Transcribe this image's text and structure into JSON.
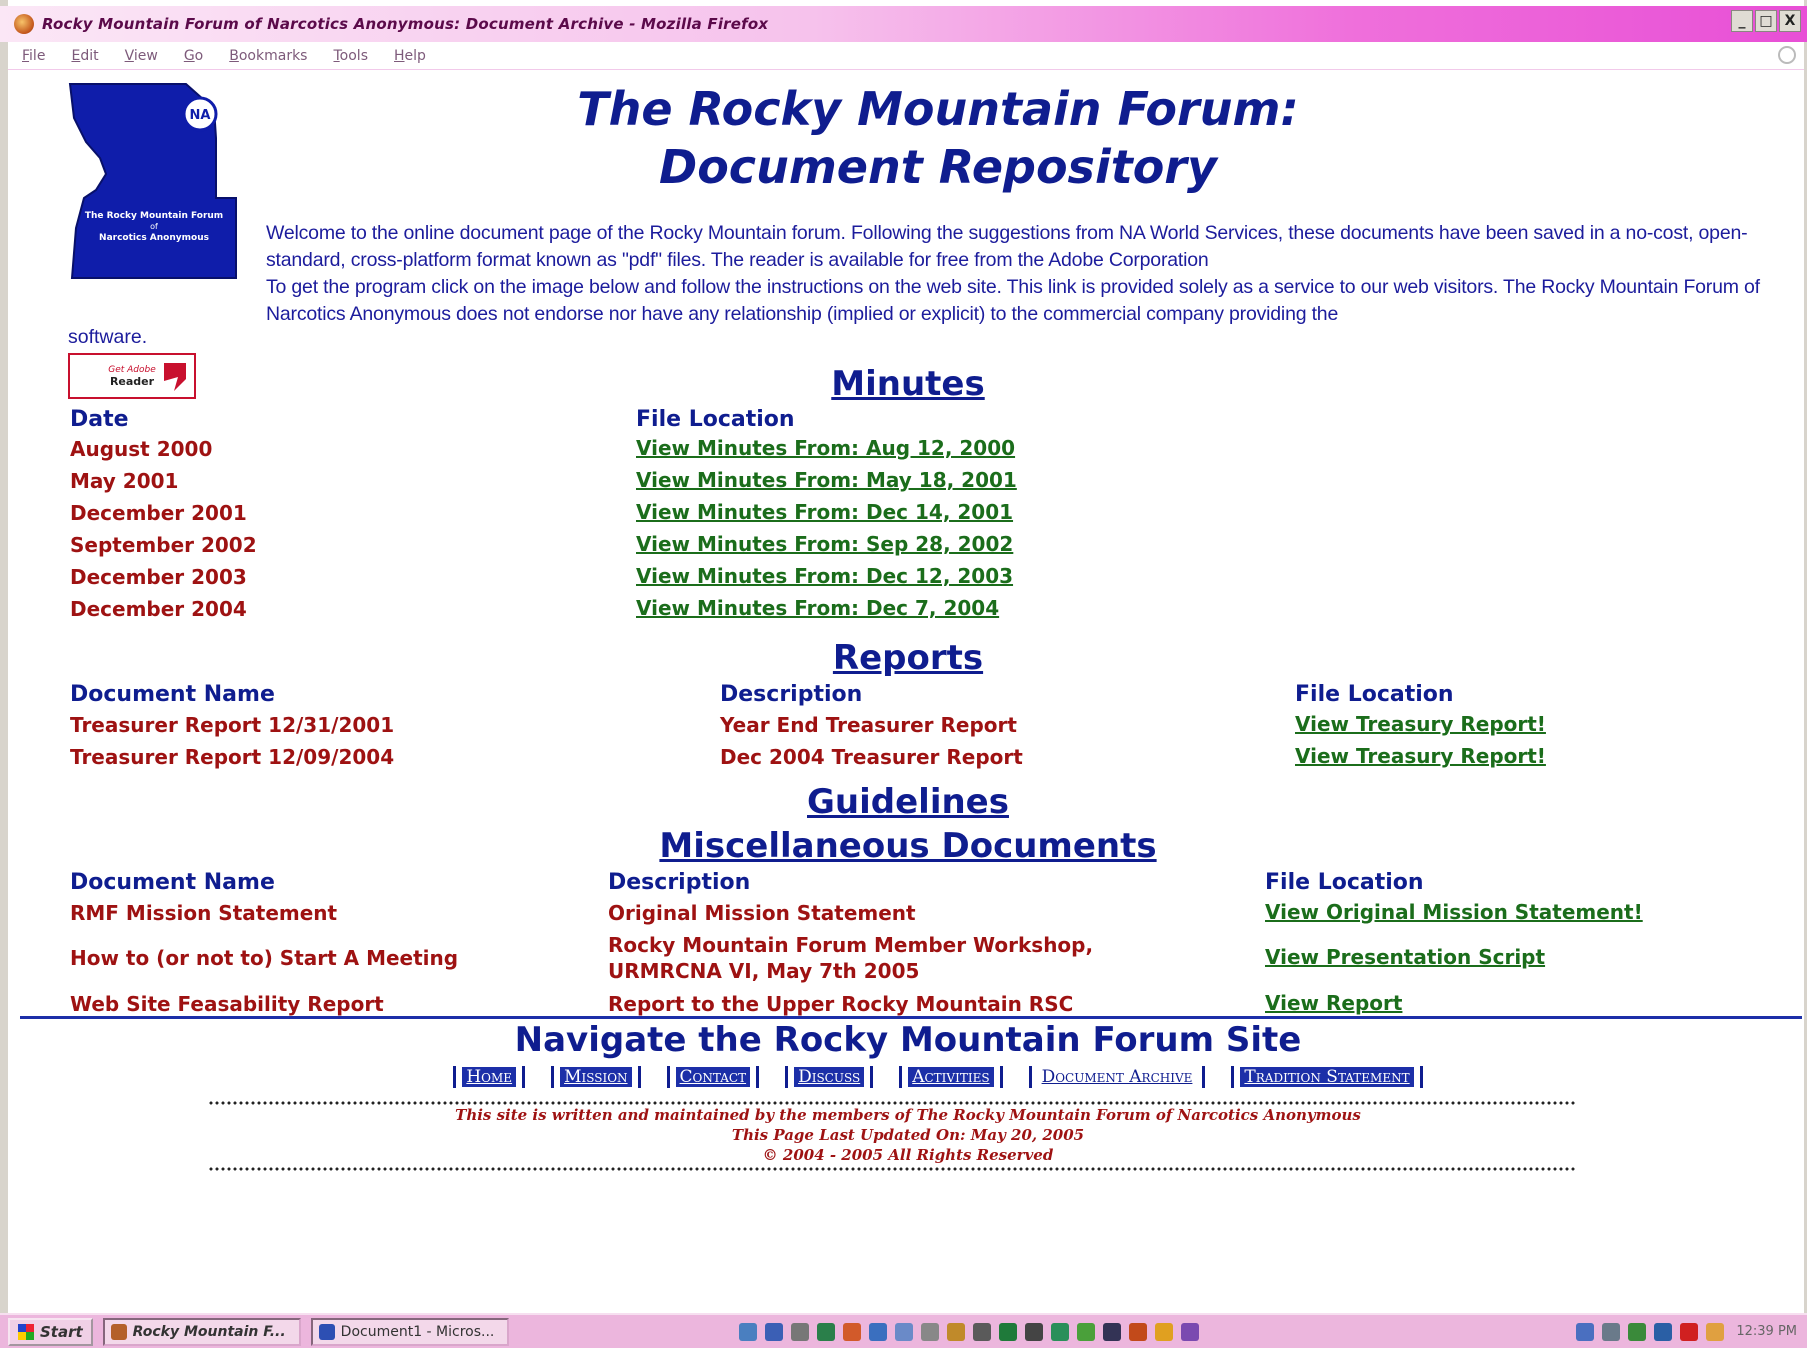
{
  "browser": {
    "window_title": "Rocky Mountain Forum of Narcotics Anonymous: Document Archive - Mozilla Firefox",
    "menus": [
      "File",
      "Edit",
      "View",
      "Go",
      "Bookmarks",
      "Tools",
      "Help"
    ],
    "window_buttons": [
      "_",
      "□",
      "X"
    ]
  },
  "page": {
    "title_line1": "The Rocky Mountain Forum:",
    "title_line2": "Document Repository",
    "logo_text_line1": "The Rocky Mountain Forum",
    "logo_text_line2": "of",
    "logo_text_line3": "Narcotics Anonymous",
    "logo_badge": "NA",
    "intro_p1": "Welcome to the online document page of the Rocky Mountain forum. Following the suggestions from NA World Services, these documents have been saved in a no-cost, open-standard, cross-platform format known as \"pdf\" files. The reader is available for free from the Adobe Corporation",
    "intro_p2": "To get the program click on the image below and follow the instructions on the web site. This link is provided solely as a service to our web visitors. The Rocky Mountain Forum of Narcotics Anonymous does not endorse nor have any relationship (implied or explicit) to the commercial company providing the",
    "intro_tail": "software.",
    "adobe_get": "Get Adobe",
    "adobe_reader": "Reader"
  },
  "minutes": {
    "title": "Minutes",
    "col_date": "Date",
    "col_location": "File Location",
    "rows": [
      {
        "date": "August 2000",
        "link": "View Minutes From: Aug 12, 2000"
      },
      {
        "date": "May 2001",
        "link": "View Minutes From: May 18, 2001"
      },
      {
        "date": "December 2001",
        "link": "View Minutes From: Dec 14, 2001"
      },
      {
        "date": "September 2002",
        "link": "View Minutes From: Sep 28, 2002"
      },
      {
        "date": "December 2003",
        "link": "View Minutes From: Dec 12, 2003"
      },
      {
        "date": "December 2004",
        "link": "View Minutes From: Dec 7, 2004"
      }
    ]
  },
  "reports": {
    "title": "Reports",
    "col_name": "Document Name",
    "col_desc": "Description",
    "col_location": "File Location",
    "rows": [
      {
        "name": "Treasurer Report 12/31/2001",
        "desc": "Year End Treasurer Report",
        "link": "View Treasury Report!"
      },
      {
        "name": "Treasurer Report 12/09/2004",
        "desc": "Dec 2004 Treasurer Report",
        "link": "View Treasury Report!"
      }
    ]
  },
  "guidelines": {
    "title": "Guidelines"
  },
  "misc": {
    "title": "Miscellaneous Documents",
    "col_name": "Document Name",
    "col_desc": "Description",
    "col_location": "File Location",
    "rows": [
      {
        "name": "RMF Mission Statement",
        "desc": "Original Mission Statement",
        "link": "View Original Mission Statement!"
      },
      {
        "name": "How to (or not to) Start A Meeting",
        "desc_line1": "Rocky Mountain Forum Member Workshop,",
        "desc_line2": "URMRCNA VI, May 7th 2005",
        "link": "View Presentation Script"
      },
      {
        "name": "Web Site Feasability Report",
        "desc": "Report to the Upper Rocky Mountain RSC",
        "link": "View Report"
      }
    ]
  },
  "nav": {
    "title": "Navigate the Rocky Mountain Forum Site",
    "items": [
      "Home",
      "Mission",
      "Contact",
      "Discuss",
      "Activities",
      "Document Archive",
      "Tradition Statement"
    ]
  },
  "footer": {
    "line1": "This site is written and maintained by the members of The Rocky Mountain Forum of Narcotics Anonymous",
    "line2": "This Page Last Updated On: May 20, 2005",
    "line3": "© 2004 - 2005 All Rights Reserved"
  },
  "taskbar": {
    "start": "Start",
    "tasks": [
      "Rocky Mountain F...",
      "Document1 - Micros..."
    ],
    "clock": "12:39 PM"
  },
  "colors": {
    "heading_blue": "#0f1d8f",
    "cell_red": "#9e1212",
    "link_green": "#1b6d1b",
    "titlebar_pink": "#e84fd6",
    "taskbar_pink": "#ecb6dd"
  }
}
